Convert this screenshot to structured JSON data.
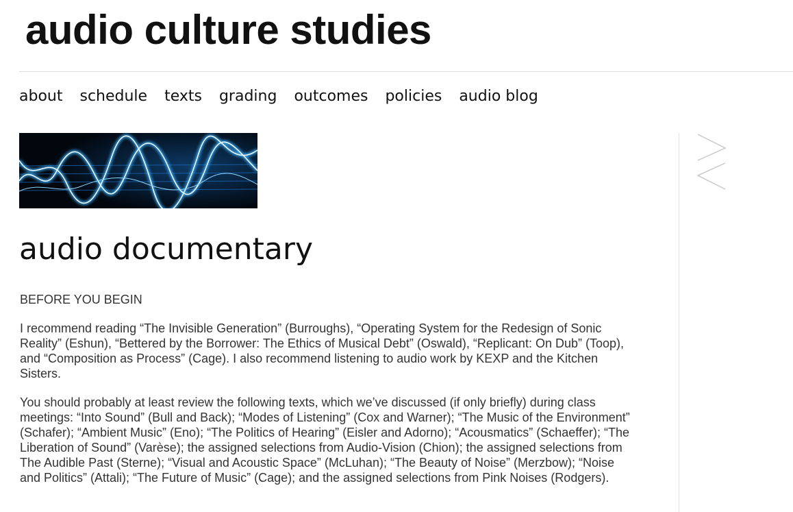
{
  "site": {
    "title": "audio culture studies"
  },
  "nav": [
    {
      "label": "about"
    },
    {
      "label": "schedule"
    },
    {
      "label": "texts"
    },
    {
      "label": "grading"
    },
    {
      "label": "outcomes"
    },
    {
      "label": "policies"
    },
    {
      "label": "audio blog"
    }
  ],
  "banner": {
    "icon": "waveform-banner-image",
    "accent": "#3fb4ff",
    "background": "#03070f"
  },
  "page": {
    "title": "audio documentary",
    "section_heading": "BEFORE YOU BEGIN",
    "paragraphs": [
      "I recommend reading “The Invisible Generation” (Burroughs), “Operating System for the Redesign of Sonic Reality” (Eshun), “Bettered by the Borrower: The Ethics of Musical Debt” (Oswald), “Replicant: On Dub” (Toop), and “Composition as Process” (Cage). I also recommend listening to audio work by KEXP and the Kitchen Sisters.",
      "You should probably at least review the following texts, which we’ve discussed (if only briefly) during class meetings: “Into Sound” (Bull and Back); “Modes of Listening” (Cox and Warner); “The Music of the Environment” (Schafer); “Ambient Music” (Eno); “The Politics of Hearing” (Eisler and Adorno); “Acousmatics” (Schaeffer); “The Liberation of Sound” (Varèse); the assigned selections from Audio-Vision (Chion); the assigned selections from The Audible Past (Sterne); “Visual and Acoustic Space” (McLuhan); “The Beauty of Noise” (Merzbow); “Noise and Politics” (Attali); “The Future of Music” (Cage); and the assigned selections from Pink Noises (Rodgers)."
    ]
  },
  "sidebar": {
    "toggle_icon": "expand-collapse-arrows-icon",
    "line_color": "#c8c8c8"
  }
}
